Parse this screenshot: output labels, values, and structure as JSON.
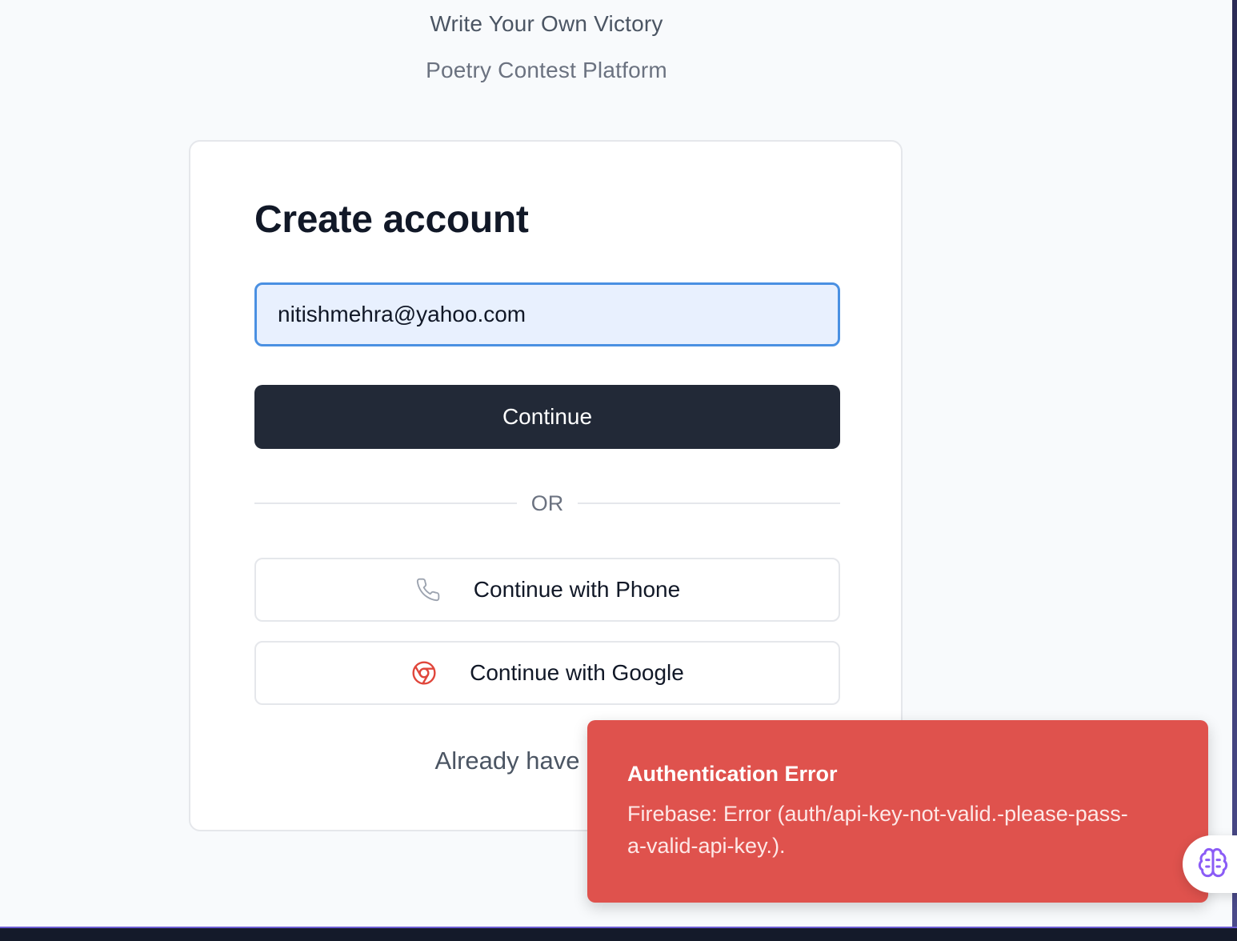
{
  "header": {
    "tagline": "Write Your Own Victory",
    "subtitle": "Poetry Contest Platform"
  },
  "card": {
    "title": "Create account",
    "email_value": "nitishmehra@yahoo.com",
    "continue_label": "Continue",
    "divider_label": "OR",
    "phone_label": "Continue with Phone",
    "google_label": "Continue with Google",
    "signin_prompt": "Already have an acc"
  },
  "toast": {
    "title": "Authentication Error",
    "message": "Firebase: Error (auth/api-key-not-valid.-please-pass-a-valid-api-key.)."
  },
  "icons": {
    "phone": "phone-icon",
    "google": "chrome-icon",
    "assistant": "brain-icon"
  },
  "colors": {
    "primary_button": "#222937",
    "input_focus_border": "#4a90e2",
    "input_fill": "#e8f0fe",
    "toast_background": "#df524d",
    "google_icon": "#e0463b",
    "assistant_icon": "#8b5cf6"
  }
}
